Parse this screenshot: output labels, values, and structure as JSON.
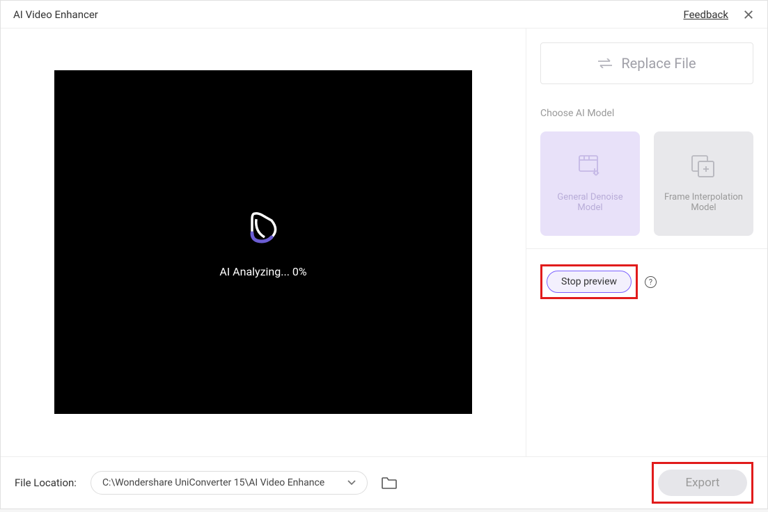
{
  "titlebar": {
    "title": "AI Video Enhancer",
    "feedback": "Feedback"
  },
  "video": {
    "analyzing": "AI Analyzing... 0%"
  },
  "sidebar": {
    "replace_label": "Replace File",
    "section": "Choose AI Model",
    "models": [
      {
        "label": "General Denoise Model"
      },
      {
        "label": "Frame Interpolation Model"
      }
    ],
    "stop_preview": "Stop preview"
  },
  "footer": {
    "label": "File Location:",
    "path": "C:\\Wondershare UniConverter 15\\AI Video Enhance",
    "export": "Export"
  }
}
